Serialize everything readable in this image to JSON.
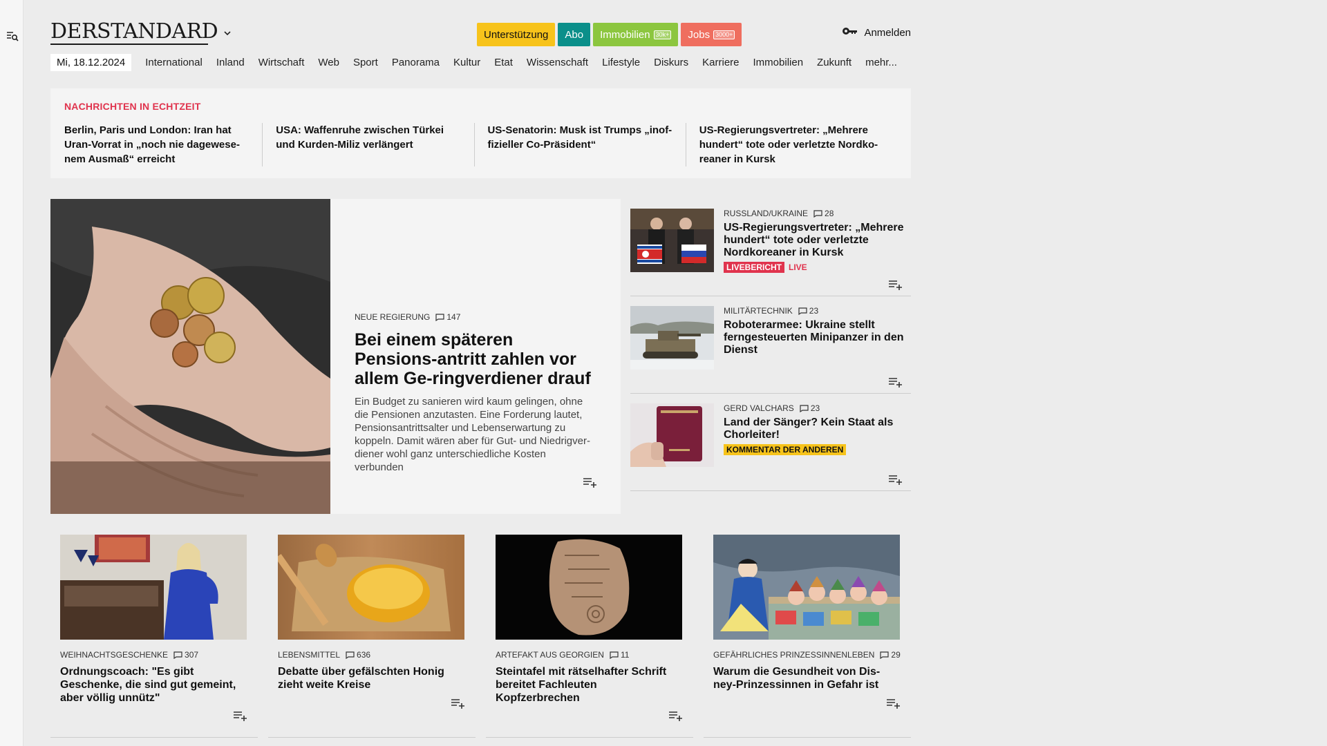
{
  "brand": {
    "logo": "DERSTANDARD"
  },
  "header": {
    "buttons": [
      {
        "label": "Unterstützung",
        "badge": ""
      },
      {
        "label": "Abo",
        "badge": ""
      },
      {
        "label": "Immobilien",
        "badge": "30k+"
      },
      {
        "label": "Jobs",
        "badge": "3000+"
      }
    ],
    "login_label": "Anmelden"
  },
  "nav": {
    "date": "Mi, 18.12.2024",
    "items": [
      "International",
      "Inland",
      "Wirtschaft",
      "Web",
      "Sport",
      "Panorama",
      "Kultur",
      "Etat",
      "Wissenschaft",
      "Lifestyle",
      "Diskurs",
      "Karriere",
      "Immobilien",
      "Zukunft",
      "mehr..."
    ]
  },
  "realtime": {
    "label": "NACHRICHTEN IN ECHTZEIT",
    "items": [
      "Berlin, Paris und London: Iran hat Uran-Vorrat in „noch nie dagewese-nem Ausmaß“ erreicht",
      "USA: Waffenruhe zwischen Türkei und Kurden-Miliz verlängert",
      "US-Senatorin: Musk ist Trumps „inof-fizieller Co-Präsident“",
      "US-Regierungsvertreter: „Mehrere hundert“ tote oder verletzte Nordko-reaner in Kursk"
    ]
  },
  "hero": {
    "kicker": "NEUE REGIERUNG",
    "comments": "147",
    "title": "Bei einem späteren Pensions-antritt zahlen vor allem Ge-ringverdiener drauf",
    "teaser": "Ein Budget zu sanieren wird kaum gelingen, ohne die Pensionen anzutasten. Eine Forderung lautet, Pensionsantrittsalter und Lebenserwartung zu koppeln. Damit wären aber für Gut- und Niedrigver-diener wohl ganz unterschiedliche Kosten verbunden"
  },
  "side": [
    {
      "kicker": "RUSSLAND/UKRAINE",
      "comments": "28",
      "title": "US-Regierungsvertreter: „Mehrere hundert“ tote oder verletzte Nordkoreaner in Kursk",
      "tag": "LIVEBERICHT",
      "tag2": "LIVE"
    },
    {
      "kicker": "MILITÄRTECHNIK",
      "comments": "23",
      "title": "Roboterarmee: Ukraine stellt ferngesteuerten Minipanzer in den Dienst"
    },
    {
      "kicker": "GERD VALCHARS",
      "comments": "23",
      "title": "Land der Sänger? Kein Staat als Chorleiter!",
      "tag": "KOMMENTAR DER ANDEREN"
    }
  ],
  "cards": [
    {
      "kicker": "WEIHNACHTSGESCHENKE",
      "comments": "307",
      "title": "Ordnungscoach: \"Es gibt Geschenke, die sind gut gemeint, aber völlig unnütz\""
    },
    {
      "kicker": "LEBENSMITTEL",
      "comments": "636",
      "title": "Debatte über gefälschten Honig zieht weite Kreise"
    },
    {
      "kicker": "ARTEFAKT AUS GEORGIEN",
      "comments": "11",
      "title": "Steintafel mit rätselhafter Schrift bereitet Fachleuten Kopfzerbrechen"
    },
    {
      "kicker": "GEFÄHRLICHES PRINZESSINNENLEBEN",
      "comments": "29",
      "title": "Warum die Gesundheit von Dis-ney-Prinzessinnen in Gefahr ist"
    }
  ],
  "colors": {
    "accent_red": "#e0334d",
    "support": "#f7c31b",
    "abo": "#0b8f8a",
    "immo": "#8cc63f",
    "jobs": "#ef6e5f"
  }
}
